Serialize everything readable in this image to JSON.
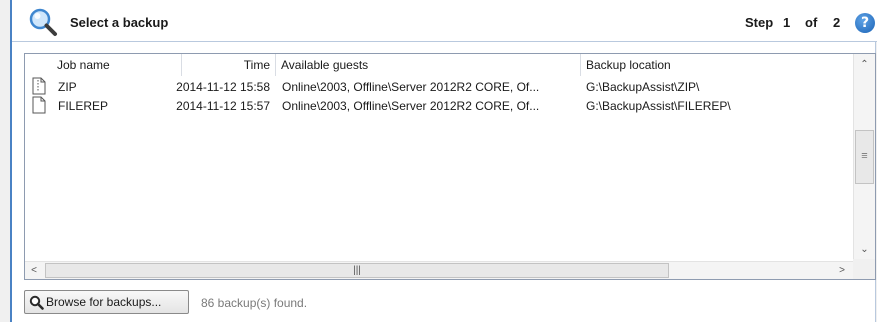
{
  "header": {
    "title": "Select a backup",
    "step_word": "Step",
    "step_current": "1",
    "step_of": "of",
    "step_total": "2",
    "help_icon": "?"
  },
  "table": {
    "columns": [
      "Job name",
      "Time",
      "Available guests",
      "Backup location"
    ],
    "rows": [
      {
        "job_name": "ZIP",
        "time": "2014-11-12 15:58",
        "guests": "Online\\2003, Offline\\Server 2012R2 CORE, Of...",
        "location": "G:\\BackupAssist\\ZIP\\"
      },
      {
        "job_name": "FILEREP",
        "time": "2014-11-12 15:57",
        "guests": "Online\\2003, Offline\\Server 2012R2 CORE, Of...",
        "location": "G:\\BackupAssist\\FILEREP\\"
      }
    ]
  },
  "footer": {
    "browse_label": "Browse for backups...",
    "found_text": "86 backup(s) found."
  },
  "icons": {
    "header": "search-magnifier-icon",
    "help": "help-icon",
    "row_file": "file-icon",
    "browse": "magnifier-icon"
  },
  "colors": {
    "accent": "#4a82c4",
    "help_blue": "#1b63b6"
  }
}
